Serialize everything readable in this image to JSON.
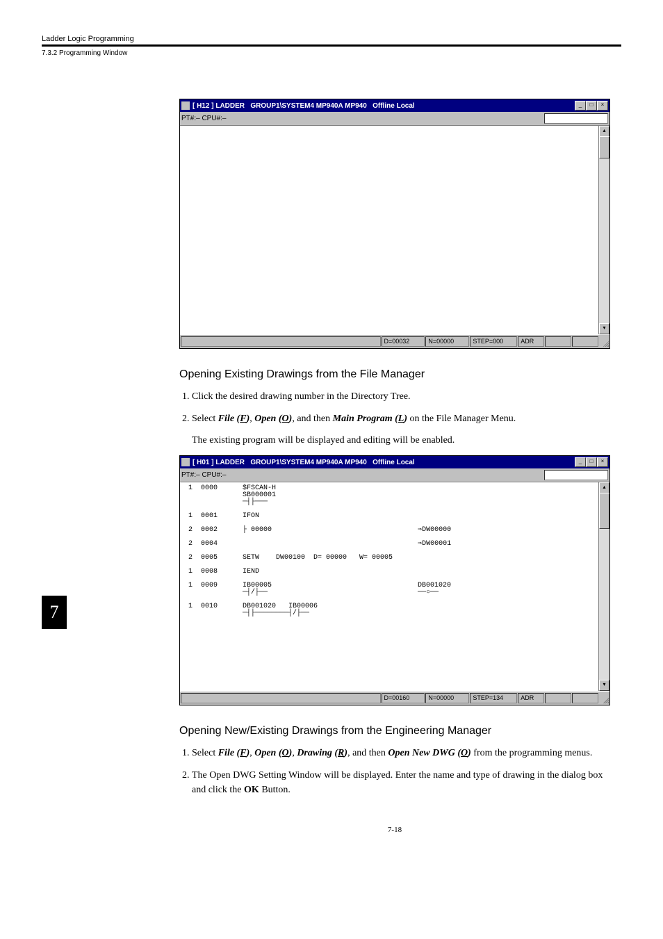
{
  "header": {
    "section_title": "Ladder Logic Programming",
    "subsection": "7.3.2  Programming Window"
  },
  "chapter_tab": "7",
  "page_number": "7-18",
  "window1": {
    "title": "[ H12 ] LADDER   GROUP1\\SYSTEM4 MP940A MP940   Offline Local",
    "toolbar_label": "PT#:– CPU#:–",
    "status": {
      "spacer_w": 280,
      "d": "D=00032",
      "n": "N=00000",
      "step": "STEP=000",
      "adr": "ADR"
    }
  },
  "section1": {
    "heading": "Opening Existing Drawings from the File Manager",
    "steps": [
      "Click the desired drawing number in the Directory Tree.",
      {
        "prefix": "Select ",
        "m1": "File (",
        "k1": "F",
        "m1b": ")",
        "sep1": ", ",
        "m2": "Open (",
        "k2": "O",
        "m2b": ")",
        "sep2": ", and then ",
        "m3": "Main Program (",
        "k3": "L",
        "m3b": ")",
        "suffix": " on the File Manager Menu.",
        "note": "The existing program will be displayed and editing will be enabled."
      }
    ]
  },
  "window2": {
    "title": "[ H01 ] LADDER   GROUP1\\SYSTEM4 MP940A MP940   Offline Local",
    "toolbar_label": "PT#:– CPU#:–",
    "rows": [
      {
        "c": "1",
        "step": "0000",
        "a": "$FSCAN-H",
        "b": "SB000001",
        "sym": "─┤├───"
      },
      {
        "c": "1",
        "step": "0001",
        "a": "IFON"
      },
      {
        "c": "2",
        "step": "0002",
        "a": "├ 00000",
        "r": "⇒DW00000"
      },
      {
        "c": "2",
        "step": "0004",
        "r": "⇒DW00001"
      },
      {
        "c": "2",
        "step": "0005",
        "a": "SETW    DW00100  D= 00000   W= 00005"
      },
      {
        "c": "1",
        "step": "0008",
        "a": "IEND"
      },
      {
        "c": "1",
        "step": "0009",
        "a": "IB00005",
        "sym": "─┤/├──",
        "r": "DB001020",
        "rsym": "──○──"
      },
      {
        "c": "1",
        "step": "0010",
        "a": "DB001020   IB00006",
        "sym": "─┤├────────┤/├──"
      }
    ],
    "status": {
      "spacer_w": 280,
      "d": "D=00160",
      "n": "N=00000",
      "step": "STEP=134",
      "adr": "ADR"
    }
  },
  "section2": {
    "heading": "Opening New/Existing Drawings from the Engineering Manager",
    "steps": [
      {
        "prefix": "Select ",
        "m1": "File (",
        "k1": "F",
        "m1b": ")",
        "sep1": ", ",
        "m2": "Open (",
        "k2": "O",
        "m2b": ")",
        "sep2": ", ",
        "m3": "Drawing (",
        "k3": "R",
        "m3b": ")",
        "sep3": ", and then ",
        "m4": "Open New DWG (",
        "k4": "O",
        "m4b": ")",
        "suffix": " from the programming menus."
      },
      {
        "text_a": "The Open DWG Setting Window will be displayed. Enter the name and type of drawing in the dialog box and click the ",
        "bold": "OK",
        "text_b": " Button."
      }
    ]
  }
}
